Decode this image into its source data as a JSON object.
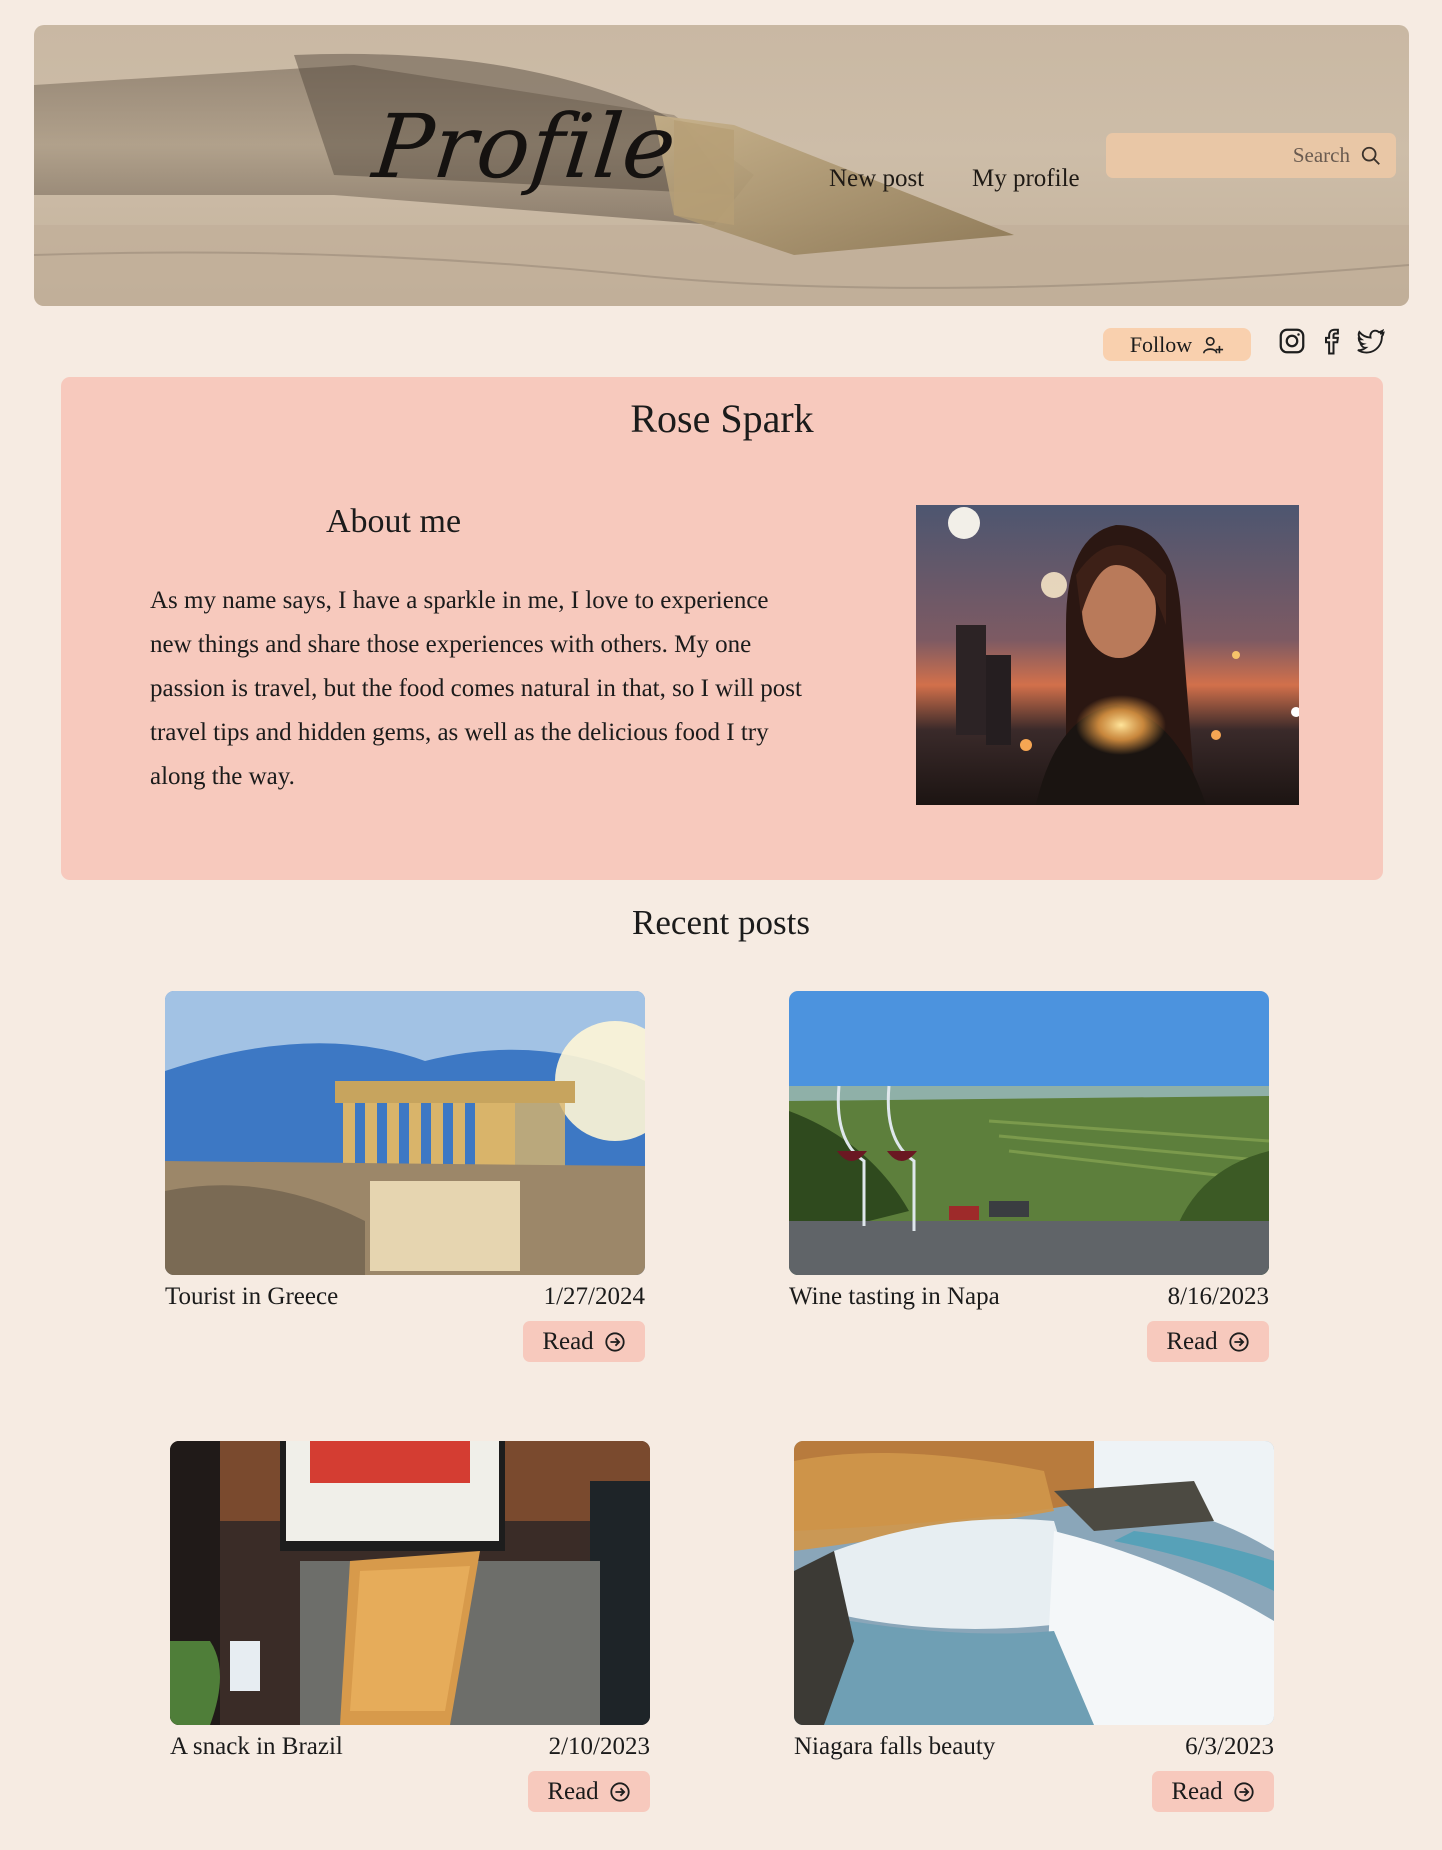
{
  "header": {
    "logo": "Profile",
    "nav": [
      "New post",
      "My profile"
    ],
    "search_placeholder": "Search"
  },
  "actions": {
    "follow_label": "Follow",
    "social": [
      "instagram-icon",
      "facebook-icon",
      "twitter-icon"
    ]
  },
  "profile": {
    "name": "Rose Spark",
    "about_title": "About me",
    "about_text": "As my name says, I have a sparkle in me, I love to experience new things and share those experiences with others. My one passion is travel, but the food comes natural in that, so I will post travel tips and hidden gems, as well as the delicious food I try along the way."
  },
  "recent": {
    "title": "Recent posts",
    "read_label": "Read",
    "posts": [
      {
        "title": "Tourist in Greece",
        "date": "1/27/2024"
      },
      {
        "title": "Wine tasting in Napa",
        "date": "8/16/2023"
      },
      {
        "title": "A snack in Brazil",
        "date": "2/10/2023"
      },
      {
        "title": "Niagara falls beauty",
        "date": "6/3/2023"
      }
    ]
  },
  "colors": {
    "background": "#f6ebe2",
    "card": "#f7c9bd",
    "search": "#e9c7a6",
    "follow": "#f9d0ae"
  }
}
